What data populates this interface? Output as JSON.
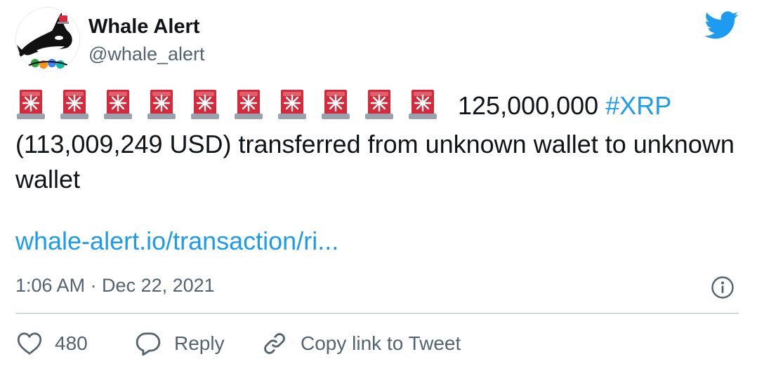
{
  "author": {
    "display_name": "Whale Alert",
    "handle": "@whale_alert",
    "avatar_icon": "whale-avatar-icon"
  },
  "brand": {
    "icon": "twitter-bird-icon",
    "color": "#1d9bf0"
  },
  "tweet": {
    "siren_icon": "police-car-light-emoji",
    "siren_count": 10,
    "amount": "125,000,000",
    "hashtag": "#XRP",
    "text_rest": "(113,009,249 USD) transferred from unknown wallet to unknown wallet",
    "link": "whale-alert.io/transaction/ri..."
  },
  "meta": {
    "timestamp": "1:06 AM · Dec 22, 2021",
    "info_icon": "info-icon"
  },
  "actions": {
    "likes_count": "480",
    "reply_label": "Reply",
    "copy_label": "Copy link to Tweet"
  },
  "colors": {
    "text": "#0f1419",
    "secondary": "#536471",
    "accent": "#1d9bf0",
    "divider": "#cfd9de",
    "siren_red": "#d42a3c"
  }
}
